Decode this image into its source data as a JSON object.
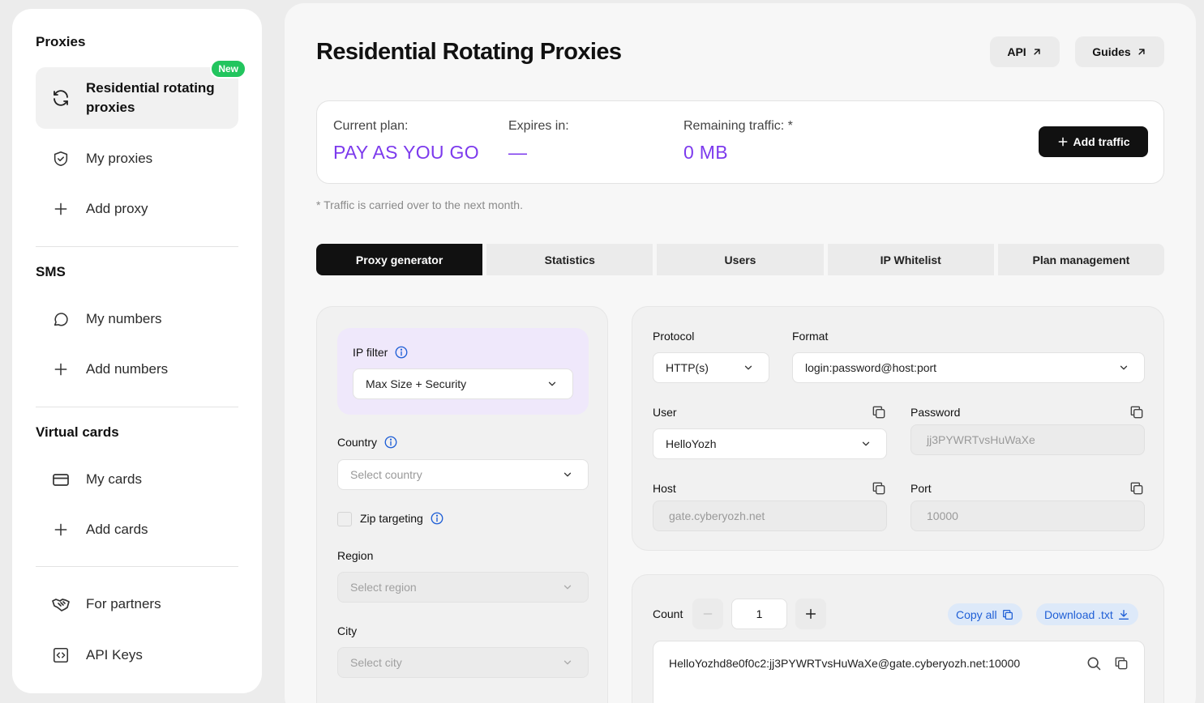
{
  "sidebar": {
    "sections": [
      {
        "title": "Proxies"
      },
      {
        "title": "SMS"
      },
      {
        "title": "Virtual cards"
      }
    ],
    "items": {
      "residential": {
        "label": "Residential rotating proxies",
        "badge": "New",
        "icon": "refresh-icon"
      },
      "my_proxies": {
        "label": "My proxies",
        "icon": "shield-icon"
      },
      "add_proxy": {
        "label": "Add proxy",
        "icon": "plus-icon"
      },
      "my_numbers": {
        "label": "My numbers",
        "icon": "chat-bubble-icon"
      },
      "add_numbers": {
        "label": "Add numbers",
        "icon": "plus-icon"
      },
      "my_cards": {
        "label": "My cards",
        "icon": "credit-card-icon"
      },
      "add_cards": {
        "label": "Add cards",
        "icon": "plus-icon"
      },
      "partners": {
        "label": "For partners",
        "icon": "handshake-icon"
      },
      "api_keys": {
        "label": "API Keys",
        "icon": "code-icon"
      }
    }
  },
  "header": {
    "title": "Residential Rotating Proxies",
    "api_label": "API",
    "guides_label": "Guides"
  },
  "plan": {
    "current_label": "Current plan:",
    "current_value": "PAY AS YOU GO",
    "expires_label": "Expires in:",
    "expires_value": "—",
    "traffic_label": "Remaining traffic: *",
    "traffic_value": "0 MB",
    "add_traffic_label": "Add traffic",
    "footnote": "* Traffic is carried over to the next month."
  },
  "tabs": [
    "Proxy generator",
    "Statistics",
    "Users",
    "IP Whitelist",
    "Plan management"
  ],
  "filters": {
    "ip_filter_label": "IP filter",
    "ip_filter_value": "Max Size + Security",
    "country_label": "Country",
    "country_placeholder": "Select country",
    "zip_label": "Zip targeting",
    "region_label": "Region",
    "region_placeholder": "Select region",
    "city_label": "City",
    "city_placeholder": "Select city"
  },
  "config": {
    "protocol_label": "Protocol",
    "protocol_value": "HTTP(s)",
    "format_label": "Format",
    "format_value": "login:password@host:port",
    "user_label": "User",
    "user_value": "HelloYozh",
    "password_label": "Password",
    "password_value": "jj3PYWRTvsHuWaXe",
    "host_label": "Host",
    "host_value": "gate.cyberyozh.net",
    "port_label": "Port",
    "port_value": "10000"
  },
  "output": {
    "count_label": "Count",
    "count_value": "1",
    "copy_all_label": "Copy all",
    "download_label": "Download .txt",
    "result_line": "HelloYozhd8e0f0c2:jj3PYWRTvsHuWaXe@gate.cyberyozh.net:10000"
  },
  "colors": {
    "accent_purple": "#7c3aed",
    "new_badge": "#22c55e",
    "link_blue": "#1f5fd6",
    "ip_filter_bg": "#efe8fb"
  }
}
